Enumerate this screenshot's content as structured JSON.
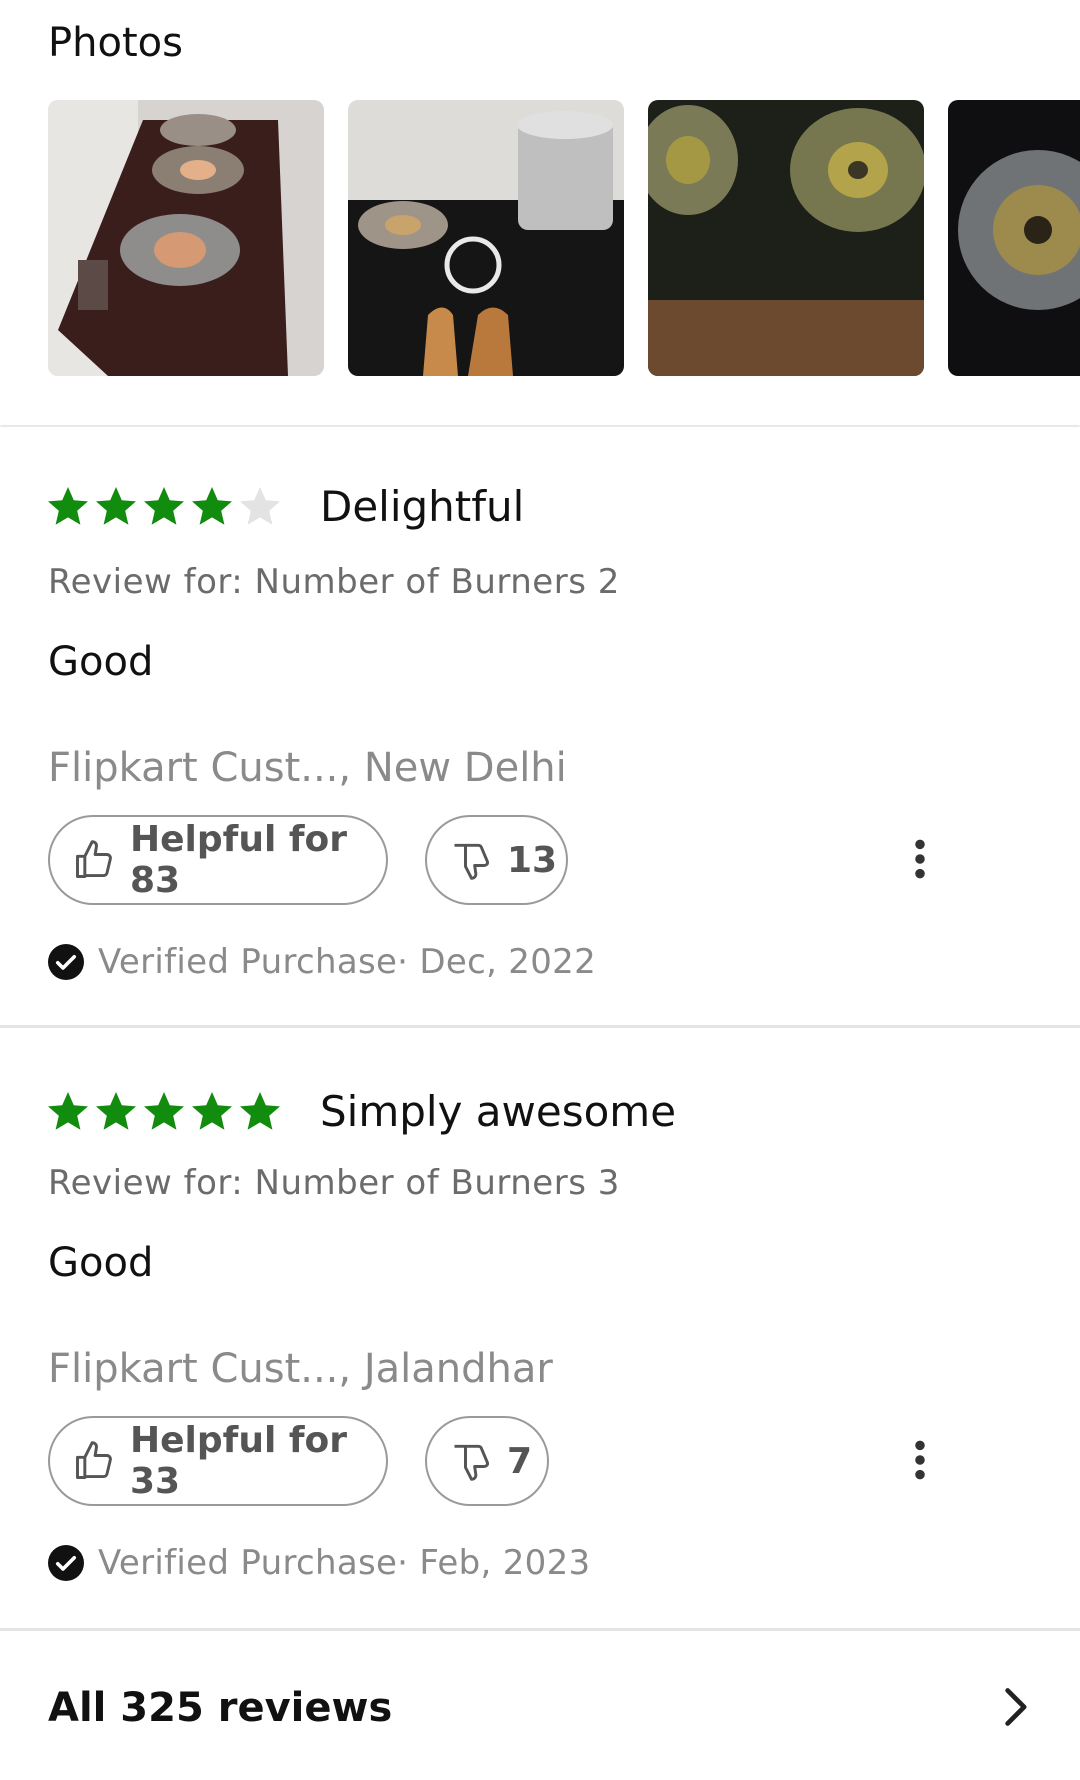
{
  "photos": {
    "title": "Photos",
    "items": [
      {
        "icon": "photo-gas-stove-three-burner"
      },
      {
        "icon": "photo-gas-stove-with-pot"
      },
      {
        "icon": "photo-gas-stove-closeup"
      },
      {
        "icon": "photo-burner-partial"
      }
    ]
  },
  "reviews": [
    {
      "rating": 4,
      "title": "Delightful",
      "variant": "Review for: Number of Burners 2",
      "body": "Good",
      "author": "Flipkart Cust..., New Delhi",
      "helpful_label": "Helpful for 83",
      "dislike_count": "13",
      "verified": "Verified Purchase· Dec, 2022"
    },
    {
      "rating": 5,
      "title": "Simply awesome",
      "variant": "Review for: Number of Burners 3",
      "body": "Good",
      "author": "Flipkart Cust..., Jalandhar",
      "helpful_label": "Helpful for 33",
      "dislike_count": "7",
      "verified": "Verified Purchase· Feb, 2023"
    }
  ],
  "footer": {
    "all_reviews_label": "All 325 reviews"
  },
  "colors": {
    "star_filled": "#128c0e",
    "star_empty": "#e3e3e3"
  }
}
